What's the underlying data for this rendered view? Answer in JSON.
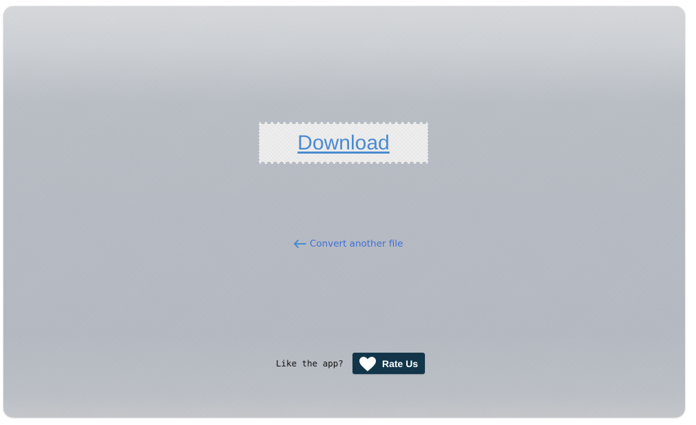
{
  "download": {
    "label": "Download"
  },
  "convert": {
    "label": "Convert another file",
    "icon": "arrow-left-icon"
  },
  "rate": {
    "prompt": "Like the app?",
    "button_label": "Rate Us",
    "icon": "heart-icon"
  },
  "colors": {
    "link_blue": "#4a8ad0",
    "convert_blue": "#3f6fd6",
    "rate_button_bg": "#12354a",
    "panel_bg": "#b6bbc3"
  }
}
